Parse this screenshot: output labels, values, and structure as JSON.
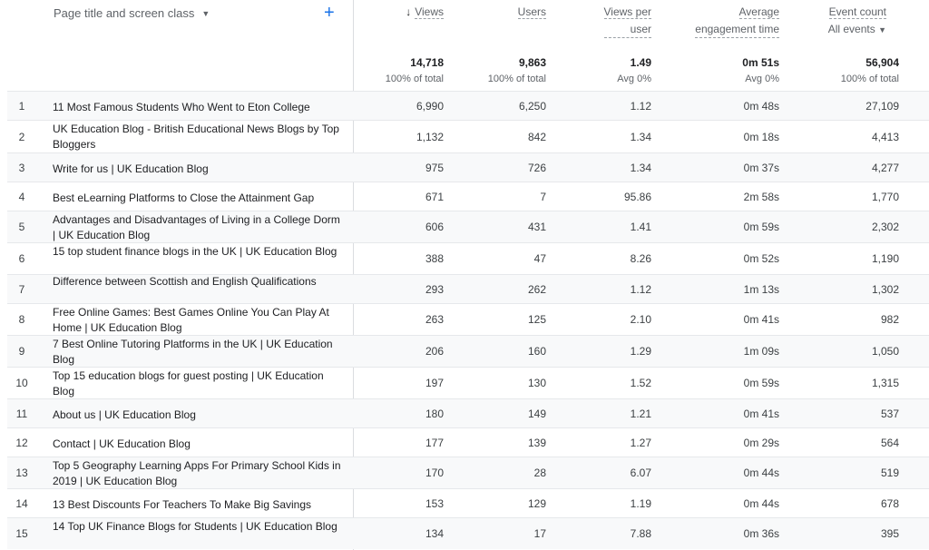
{
  "header": {
    "dimension_label": "Page title and screen class",
    "columns": [
      {
        "key": "views",
        "label": "Views",
        "sub": "",
        "sorted": true
      },
      {
        "key": "users",
        "label": "Users",
        "sub": ""
      },
      {
        "key": "views_per_user",
        "label": "Views per",
        "sub": "user"
      },
      {
        "key": "avg_eng",
        "label": "Average",
        "sub": "engagement time"
      },
      {
        "key": "event_count",
        "label": "Event count",
        "sub": "All events"
      }
    ]
  },
  "totals": {
    "views": "14,718",
    "views_sub": "100% of total",
    "users": "9,863",
    "users_sub": "100% of total",
    "views_per_user": "1.49",
    "views_per_user_sub": "Avg 0%",
    "avg_eng": "0m 51s",
    "avg_eng_sub": "Avg 0%",
    "event_count": "56,904",
    "event_count_sub": "100% of total"
  },
  "rows": [
    {
      "idx": "1",
      "title": "11 Most Famous Students Who Went to Eton College",
      "views": "6,990",
      "users": "6,250",
      "vpu": "1.12",
      "eng": "0m 48s",
      "events": "27,109"
    },
    {
      "idx": "2",
      "title": "UK Education Blog - British Educational News Blogs by Top Bloggers",
      "views": "1,132",
      "users": "842",
      "vpu": "1.34",
      "eng": "0m 18s",
      "events": "4,413"
    },
    {
      "idx": "3",
      "title": "Write for us | UK Education Blog",
      "views": "975",
      "users": "726",
      "vpu": "1.34",
      "eng": "0m 37s",
      "events": "4,277"
    },
    {
      "idx": "4",
      "title": "Best eLearning Platforms to Close the Attainment Gap",
      "views": "671",
      "users": "7",
      "vpu": "95.86",
      "eng": "2m 58s",
      "events": "1,770"
    },
    {
      "idx": "5",
      "title": "Advantages and Disadvantages of Living in a College Dorm | UK Education Blog",
      "views": "606",
      "users": "431",
      "vpu": "1.41",
      "eng": "0m 59s",
      "events": "2,302"
    },
    {
      "idx": "6",
      "title": "15 top student finance blogs in the UK | UK Education Blog",
      "views": "388",
      "users": "47",
      "vpu": "8.26",
      "eng": "0m 52s",
      "events": "1,190"
    },
    {
      "idx": "7",
      "title": "Difference between Scottish and English Qualifications",
      "views": "293",
      "users": "262",
      "vpu": "1.12",
      "eng": "1m 13s",
      "events": "1,302"
    },
    {
      "idx": "8",
      "title": "Free Online Games: Best Games Online You Can Play At Home | UK Education Blog",
      "views": "263",
      "users": "125",
      "vpu": "2.10",
      "eng": "0m 41s",
      "events": "982"
    },
    {
      "idx": "9",
      "title": "7 Best Online Tutoring Platforms in the UK | UK Education Blog",
      "views": "206",
      "users": "160",
      "vpu": "1.29",
      "eng": "1m 09s",
      "events": "1,050"
    },
    {
      "idx": "10",
      "title": "Top 15 education blogs for guest posting | UK Education Blog",
      "views": "197",
      "users": "130",
      "vpu": "1.52",
      "eng": "0m 59s",
      "events": "1,315"
    },
    {
      "idx": "11",
      "title": "About us | UK Education Blog",
      "views": "180",
      "users": "149",
      "vpu": "1.21",
      "eng": "0m 41s",
      "events": "537"
    },
    {
      "idx": "12",
      "title": "Contact | UK Education Blog",
      "views": "177",
      "users": "139",
      "vpu": "1.27",
      "eng": "0m 29s",
      "events": "564"
    },
    {
      "idx": "13",
      "title": "Top 5 Geography Learning Apps For Primary School Kids in 2019 | UK Education Blog",
      "views": "170",
      "users": "28",
      "vpu": "6.07",
      "eng": "0m 44s",
      "events": "519"
    },
    {
      "idx": "14",
      "title": "13 Best Discounts For Teachers To Make Big Savings",
      "views": "153",
      "users": "129",
      "vpu": "1.19",
      "eng": "0m 44s",
      "events": "678"
    },
    {
      "idx": "15",
      "title": "14 Top UK Finance Blogs for Students | UK Education Blog",
      "views": "134",
      "users": "17",
      "vpu": "7.88",
      "eng": "0m 36s",
      "events": "395"
    }
  ],
  "icons": {
    "sort": "arrow-down-icon",
    "add": "plus-icon",
    "dropdown": "caret-down-icon"
  },
  "colors": {
    "accent": "#1a73e8",
    "divider": "#dadce0",
    "row_alt": "#f8f9fa"
  }
}
